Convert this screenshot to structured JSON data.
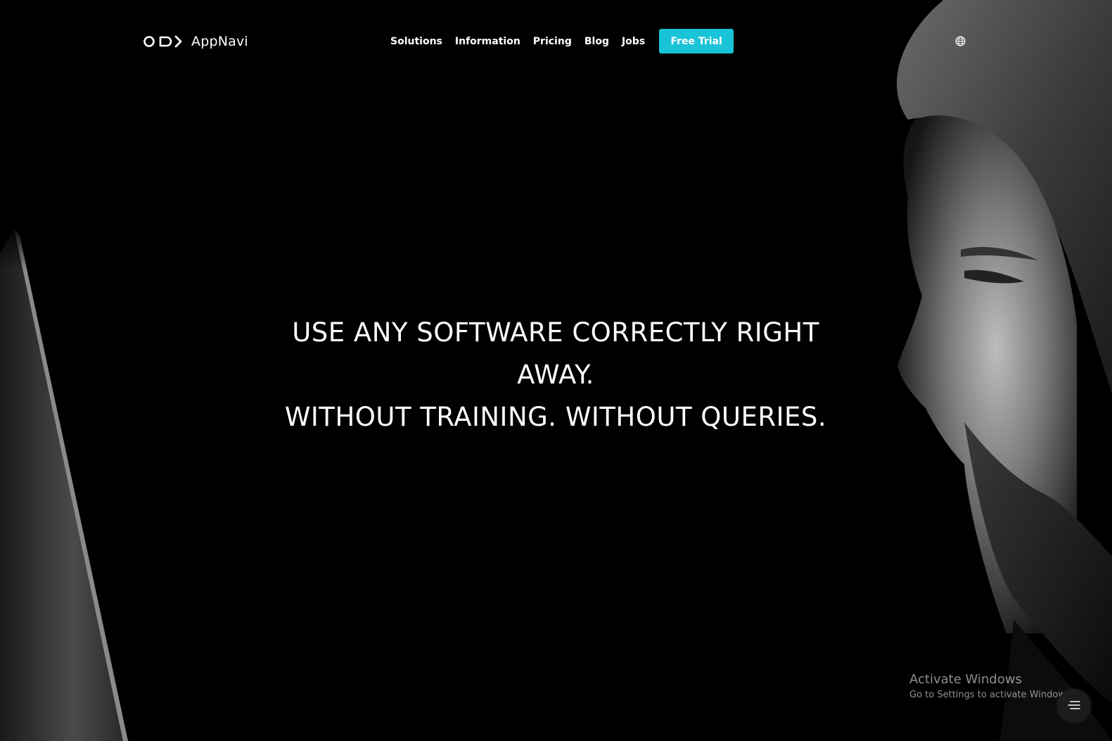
{
  "header": {
    "logo_text": "AppNavi",
    "nav": [
      {
        "label": "Solutions"
      },
      {
        "label": "Information"
      },
      {
        "label": "Pricing"
      },
      {
        "label": "Blog"
      },
      {
        "label": "Jobs"
      }
    ],
    "cta_label": "Free Trial",
    "language_icon": "globe-icon"
  },
  "hero": {
    "line1": "USE ANY SOFTWARE CORRECTLY RIGHT",
    "line2": "AWAY.",
    "line3": "WITHOUT TRAINING. WITHOUT QUERIES."
  },
  "watermark": {
    "title": "Activate Windows",
    "subtitle": "Go to Settings to activate Windows."
  },
  "floating_button": {
    "icon": "menu-lines-icon"
  },
  "colors": {
    "background": "#000000",
    "accent": "#19c3d8",
    "text": "#ffffff"
  }
}
